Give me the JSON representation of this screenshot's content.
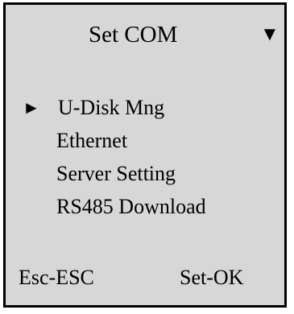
{
  "screen": {
    "title": "Set COM",
    "scroll_indicator": "▼",
    "scroll_indicator_icon": "triangle-down-icon",
    "background_color": "#d7d7d7",
    "border_color": "#000000"
  },
  "menu": {
    "selected_marker": "►",
    "selected_marker_icon": "triangle-right-icon",
    "items": [
      {
        "label": "U-Disk Mng",
        "selected": true
      },
      {
        "label": "Ethernet",
        "selected": false
      },
      {
        "label": "Server Setting",
        "selected": false
      },
      {
        "label": "RS485 Download",
        "selected": false
      }
    ]
  },
  "footer": {
    "left": "Esc-ESC",
    "right": "Set-OK"
  }
}
